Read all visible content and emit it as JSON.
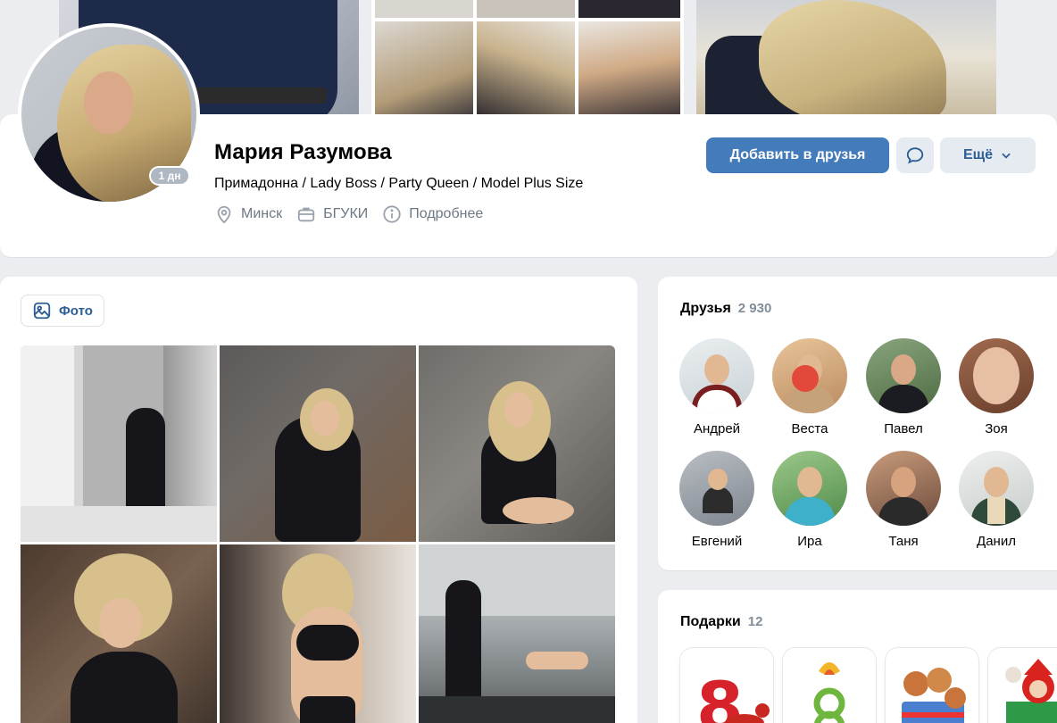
{
  "profile": {
    "name": "Мария Разумова",
    "status": "Примадонна / Lady Boss / Party Queen / Model Plus Size",
    "online": "1 дн",
    "city": "Минск",
    "education": "БГУКИ",
    "details": "Подробнее"
  },
  "actions": {
    "add_friend": "Добавить в друзья",
    "more": "Ещё"
  },
  "photos": {
    "tab_label": "Фото"
  },
  "friends": {
    "title": "Друзья",
    "count": "2 930",
    "items": [
      {
        "name": "Андрей"
      },
      {
        "name": "Веста"
      },
      {
        "name": "Павел"
      },
      {
        "name": "Зоя"
      },
      {
        "name": "Евгений"
      },
      {
        "name": "Ира"
      },
      {
        "name": "Таня"
      },
      {
        "name": "Данил"
      }
    ]
  },
  "gifts": {
    "title": "Подарки",
    "count": "12"
  },
  "colors": {
    "accent": "#447bba",
    "link": "#2c5d94",
    "secondary_text": "#6d7885",
    "page_bg": "#ebedf0"
  },
  "icons": {
    "location": "location-pin-icon",
    "education": "briefcase-icon",
    "info": "info-icon",
    "message": "message-icon",
    "chevron": "chevron-down-icon",
    "photo": "photo-icon"
  }
}
